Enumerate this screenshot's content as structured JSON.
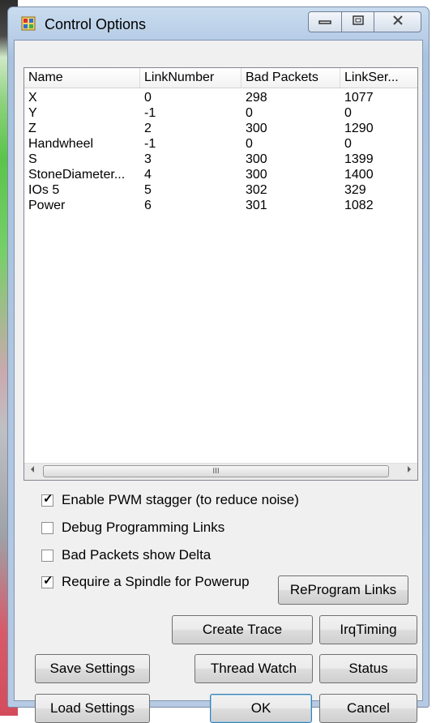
{
  "window": {
    "title": "Control Options"
  },
  "listview": {
    "columns": [
      "Name",
      "LinkNumber",
      "Bad Packets",
      "LinkSer..."
    ],
    "rows": [
      [
        "X",
        "0",
        "298",
        "1077"
      ],
      [
        "Y",
        "-1",
        "0",
        "0"
      ],
      [
        "Z",
        "2",
        "300",
        "1290"
      ],
      [
        "Handwheel",
        "-1",
        "0",
        "0"
      ],
      [
        "S",
        "3",
        "300",
        "1399"
      ],
      [
        "StoneDiameter...",
        "4",
        "300",
        "1400"
      ],
      [
        "IOs 5",
        "5",
        "302",
        "329"
      ],
      [
        "Power",
        "6",
        "301",
        "1082"
      ]
    ],
    "scroll_thumb_label": "III"
  },
  "checkboxes": [
    {
      "label": "Enable PWM stagger (to reduce noise)",
      "checked": true
    },
    {
      "label": "Debug Programming Links",
      "checked": false
    },
    {
      "label": "Bad Packets show Delta",
      "checked": false
    },
    {
      "label": "Require a Spindle for Powerup",
      "checked": true
    }
  ],
  "buttons": {
    "reprogram": "ReProgram Links",
    "create_trace": "Create Trace",
    "irq_timing": "IrqTiming",
    "save_settings": "Save Settings",
    "thread_watch": "Thread Watch",
    "status": "Status",
    "load_settings": "Load Settings",
    "ok": "OK",
    "cancel": "Cancel"
  }
}
